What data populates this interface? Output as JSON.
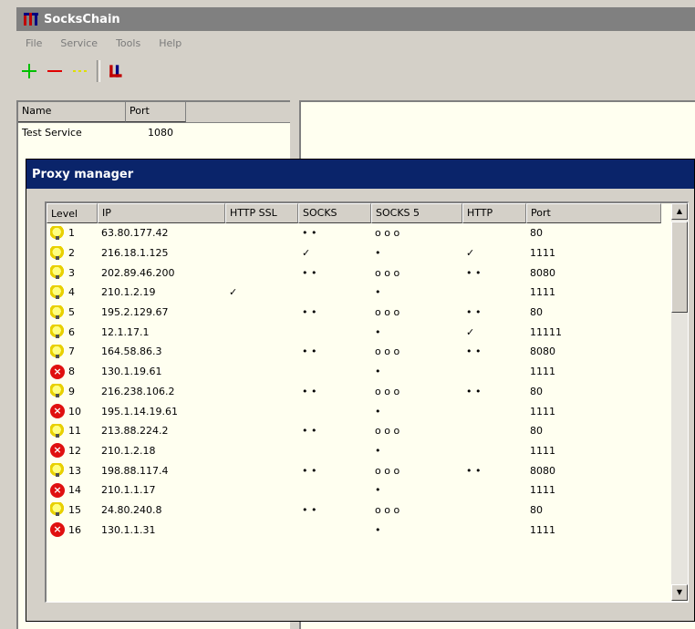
{
  "app": {
    "title": "SocksChain",
    "icon": "app-logo-icon"
  },
  "menu": [
    "File",
    "Service",
    "Tools",
    "Help"
  ],
  "toolbar": {
    "add_icon": "plus-icon",
    "remove_icon": "minus-icon",
    "edit_icon": "dots-icon",
    "logo_icon": "app-logo-icon"
  },
  "left_table": {
    "headers": [
      "Name",
      "Port"
    ],
    "rows": [
      {
        "name": "Test Service",
        "port": "1080"
      }
    ]
  },
  "dialog": {
    "title": "Proxy manager",
    "headers": [
      "Level",
      "IP",
      "HTTP SSL",
      "SOCKS",
      "SOCKS 5",
      "HTTP",
      "Port"
    ],
    "rows": [
      {
        "n": "1",
        "ip": "63.80.177.42",
        "c2": "",
        "c3": "• •",
        "c4": "o o o",
        "c5": "",
        "port": "80",
        "icon": "bulb"
      },
      {
        "n": "2",
        "ip": "216.18.1.125",
        "c2": "",
        "c3": "✓",
        "c4": "•",
        "c5": "✓",
        "port": "1111",
        "icon": "bulb"
      },
      {
        "n": "3",
        "ip": "202.89.46.200",
        "c2": "",
        "c3": "• •",
        "c4": "o o o",
        "c5": "• •",
        "port": "8080",
        "icon": "bulb"
      },
      {
        "n": "4",
        "ip": "210.1.2.19",
        "c2": "✓",
        "c3": "",
        "c4": "•",
        "c5": "",
        "port": "1111",
        "icon": "bulb"
      },
      {
        "n": "5",
        "ip": "195.2.129.67",
        "c2": "",
        "c3": "• •",
        "c4": "o o o",
        "c5": "• •",
        "port": "80",
        "icon": "bulb"
      },
      {
        "n": "6",
        "ip": "12.1.17.1",
        "c2": "",
        "c3": "",
        "c4": "•",
        "c5": "✓",
        "port": "11111",
        "icon": "bulb"
      },
      {
        "n": "7",
        "ip": "164.58.86.3",
        "c2": "",
        "c3": "• •",
        "c4": "o o o",
        "c5": "• •",
        "port": "8080",
        "icon": "bulb"
      },
      {
        "n": "8",
        "ip": "130.1.19.61",
        "c2": "",
        "c3": "",
        "c4": "•",
        "c5": "",
        "port": "1111",
        "icon": "err"
      },
      {
        "n": "9",
        "ip": "216.238.106.2",
        "c2": "",
        "c3": "• •",
        "c4": "o o o",
        "c5": "• •",
        "port": "80",
        "icon": "bulb"
      },
      {
        "n": "10",
        "ip": "195.1.14.19.61",
        "c2": "",
        "c3": "",
        "c4": "•",
        "c5": "",
        "port": "1111",
        "icon": "err"
      },
      {
        "n": "11",
        "ip": "213.88.224.2",
        "c2": "",
        "c3": "• •",
        "c4": "o o o",
        "c5": "",
        "port": "80",
        "icon": "bulb"
      },
      {
        "n": "12",
        "ip": "210.1.2.18",
        "c2": "",
        "c3": "",
        "c4": "•",
        "c5": "",
        "port": "1111",
        "icon": "err"
      },
      {
        "n": "13",
        "ip": "198.88.117.4",
        "c2": "",
        "c3": "• •",
        "c4": "o o o",
        "c5": "• •",
        "port": "8080",
        "icon": "bulb"
      },
      {
        "n": "14",
        "ip": "210.1.1.17",
        "c2": "",
        "c3": "",
        "c4": "•",
        "c5": "",
        "port": "1111",
        "icon": "err"
      },
      {
        "n": "15",
        "ip": "24.80.240.8",
        "c2": "",
        "c3": "• •",
        "c4": "o o o",
        "c5": "",
        "port": "80",
        "icon": "bulb"
      },
      {
        "n": "16",
        "ip": "130.1.1.31",
        "c2": "",
        "c3": "",
        "c4": "•",
        "c5": "",
        "port": "1111",
        "icon": "err"
      }
    ]
  },
  "colors": {
    "titlebar": "#808080",
    "dialog_title": "#0a246a",
    "add": "#00c000",
    "remove": "#e00000",
    "edit": "#e0e000"
  }
}
